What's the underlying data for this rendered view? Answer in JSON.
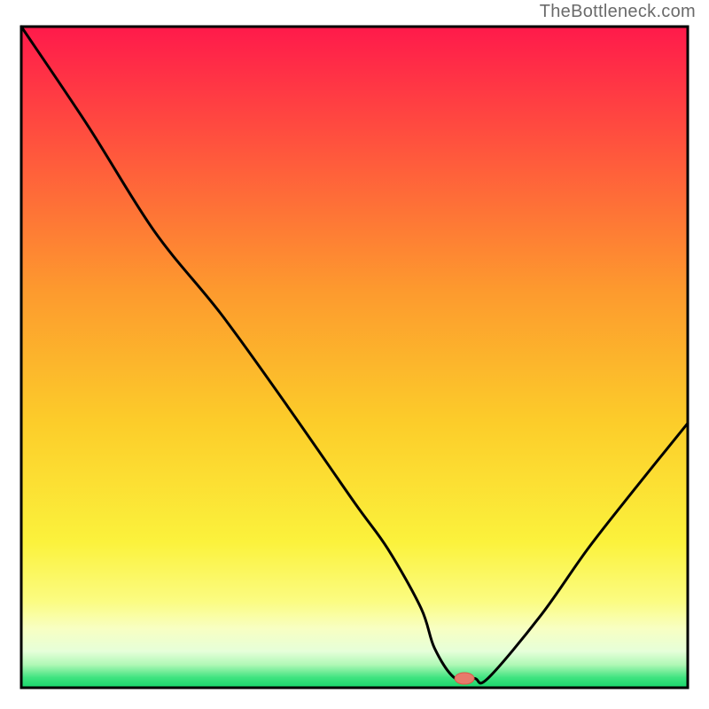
{
  "watermark": "TheBottleneck.com",
  "chart_data": {
    "type": "line",
    "title": "",
    "xlabel": "",
    "ylabel": "",
    "xlim": [
      0,
      100
    ],
    "ylim": [
      0,
      100
    ],
    "grid": false,
    "series": [
      {
        "name": "curve",
        "x": [
          0,
          10,
          20,
          30,
          40,
          50,
          55,
          60,
          62,
          65,
          68,
          70,
          78,
          85,
          92,
          100
        ],
        "y": [
          100,
          85,
          69,
          56.5,
          42.5,
          28,
          21,
          12,
          6,
          1.5,
          1.4,
          1.4,
          11,
          21,
          30,
          40
        ]
      }
    ],
    "highlight_point": {
      "x": 66.5,
      "y": 1.4
    },
    "gradient_stops": [
      {
        "offset": 0.0,
        "color": "#ff1a4b"
      },
      {
        "offset": 0.2,
        "color": "#ff5a3c"
      },
      {
        "offset": 0.4,
        "color": "#fd9a2e"
      },
      {
        "offset": 0.6,
        "color": "#fccd2a"
      },
      {
        "offset": 0.78,
        "color": "#fbf23c"
      },
      {
        "offset": 0.87,
        "color": "#fbfc82"
      },
      {
        "offset": 0.91,
        "color": "#f8ffc2"
      },
      {
        "offset": 0.945,
        "color": "#e6ffd9"
      },
      {
        "offset": 0.965,
        "color": "#b0f8b6"
      },
      {
        "offset": 0.985,
        "color": "#3ee37f"
      },
      {
        "offset": 1.0,
        "color": "#17d66b"
      }
    ]
  }
}
